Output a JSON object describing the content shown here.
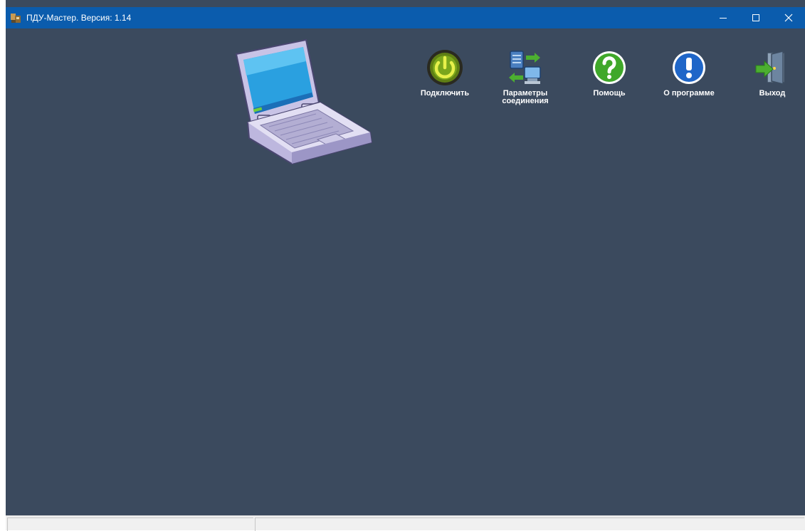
{
  "window": {
    "title": "ПДУ-Мастер. Версия: 1.14",
    "app_icon": "app-icon",
    "controls": {
      "minimize": "minimize-icon",
      "maximize": "maximize-icon",
      "close": "close-icon"
    }
  },
  "toolbar": {
    "connect": {
      "label": "Подключить",
      "icon": "power-icon"
    },
    "connection_params": {
      "label_line1": "Параметры",
      "label_line2": "соединения",
      "icon": "network-settings-icon"
    },
    "help": {
      "label": "Помощь",
      "icon": "help-icon"
    },
    "about": {
      "label": "О программе",
      "icon": "info-icon"
    },
    "exit": {
      "label": "Выход",
      "icon": "exit-door-icon"
    }
  },
  "illustration": {
    "icon": "laptop-icon"
  },
  "statusbar": {
    "panel1": "",
    "panel2": ""
  },
  "colors": {
    "titlebar": "#0b5cad",
    "background": "#3b4a5e",
    "statusbar": "#f0f0f0"
  }
}
